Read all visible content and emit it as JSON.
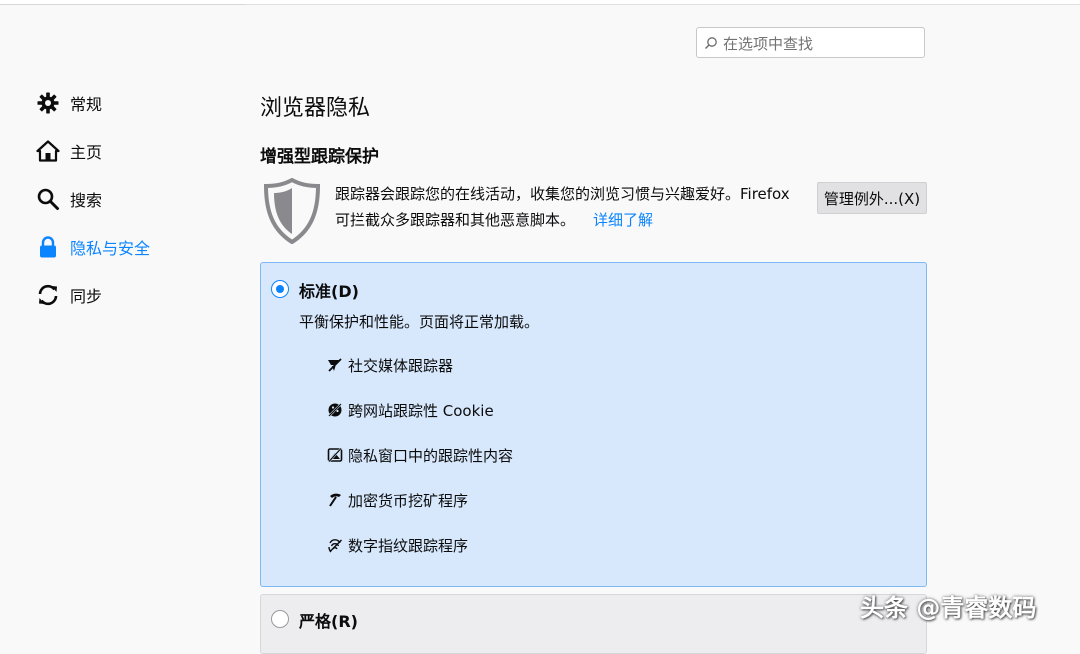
{
  "search": {
    "placeholder": "在选项中查找"
  },
  "sidebar": {
    "items": [
      {
        "label": "常规",
        "icon": "gear-icon"
      },
      {
        "label": "主页",
        "icon": "home-icon"
      },
      {
        "label": "搜索",
        "icon": "search-icon"
      },
      {
        "label": "隐私与安全",
        "icon": "lock-icon",
        "active": true
      },
      {
        "label": "同步",
        "icon": "sync-icon"
      }
    ],
    "active_color": "#0a84ff"
  },
  "main": {
    "title": "浏览器隐私",
    "section_title": "增强型跟踪保护",
    "description_line1": "跟踪器会跟踪您的在线活动，收集您的浏览习惯与兴趣爱好。Firefox",
    "description_line2": "可拦截众多跟踪器和其他恶意脚本。",
    "learn_more": "详细了解",
    "exceptions_button": "管理例外...(X)"
  },
  "protection": {
    "standard": {
      "label": "标准(D)",
      "selected": true,
      "description": "平衡保护和性能。页面将正常加载。",
      "trackers": [
        {
          "label": "社交媒体跟踪器",
          "icon": "social-tracker-icon"
        },
        {
          "label": "跨网站跟踪性 Cookie",
          "icon": "cookie-icon"
        },
        {
          "label": "隐私窗口中的跟踪性内容",
          "icon": "tracking-content-icon"
        },
        {
          "label": "加密货币挖矿程序",
          "icon": "cryptominer-icon"
        },
        {
          "label": "数字指纹跟踪程序",
          "icon": "fingerprint-icon"
        }
      ]
    },
    "strict": {
      "label": "严格(R)",
      "selected": false
    }
  },
  "colors": {
    "accent": "#0a84ff",
    "card_bg": "#d7e8fc",
    "card_border": "#7fb8f5"
  },
  "watermark": "头条 @青睿数码"
}
